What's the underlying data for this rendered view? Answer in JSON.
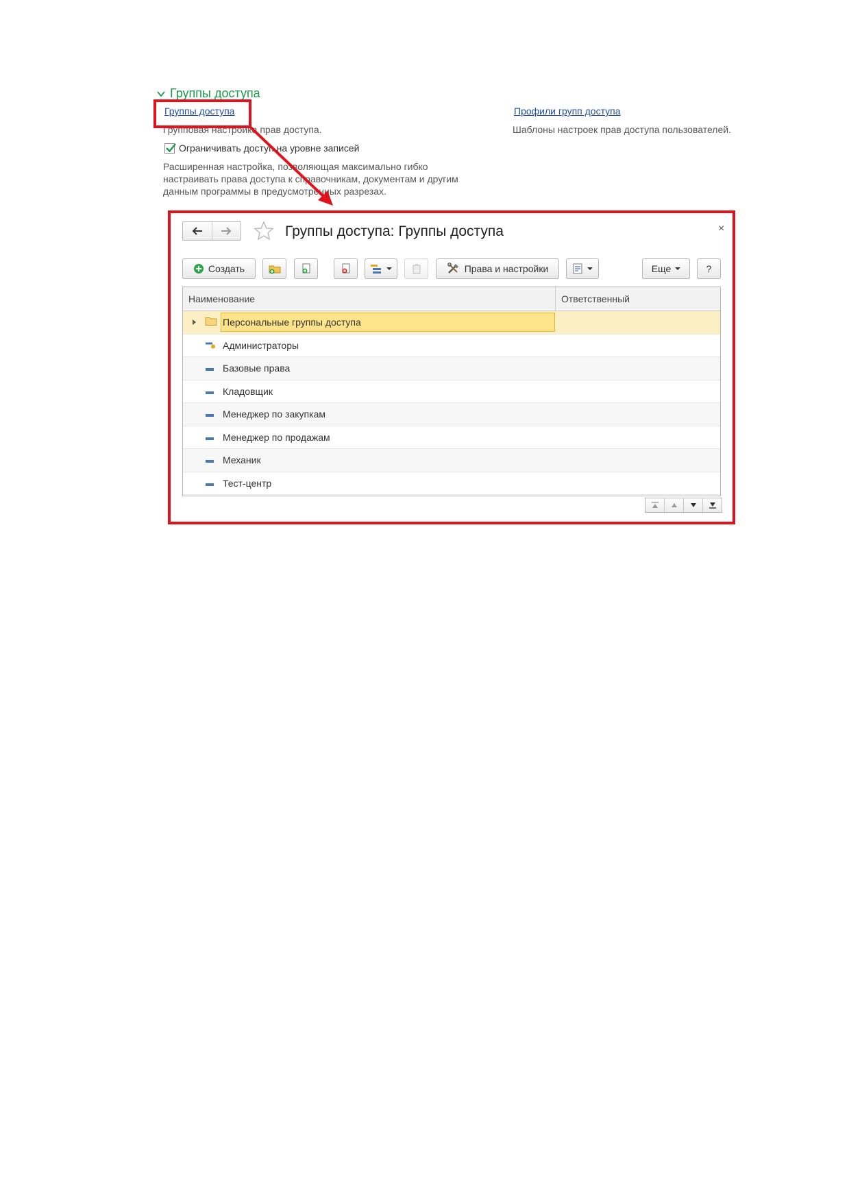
{
  "settings": {
    "section_title": "Группы доступа",
    "link_access_groups": "Группы доступа",
    "desc_access_groups": "Групповая настройка прав доступа.",
    "link_profiles": "Профили групп доступа",
    "desc_profiles": "Шаблоны настроек прав доступа пользователей.",
    "checkbox_label": "Ограничивать доступ на уровне записей",
    "checkbox_checked": true,
    "checkbox_desc_lines": [
      "Расширенная настройка, позволяющая максимально гибко",
      "настраивать права доступа к справочникам, документам и другим",
      "данным программы в предусмотренных разрезах."
    ]
  },
  "window": {
    "title": "Группы доступа: Группы доступа",
    "close_glyph": "×",
    "toolbar": {
      "create_label": "Создать",
      "rights_label": "Права и настройки",
      "more_label": "Еще",
      "help_label": "?"
    },
    "table": {
      "columns": [
        "Наименование",
        "Ответственный"
      ],
      "rows": [
        {
          "name": "Персональные группы доступа",
          "icon": "folder-icon",
          "selected": true
        },
        {
          "name": "Администраторы",
          "icon": "admin-group-icon"
        },
        {
          "name": "Базовые права",
          "icon": "group-item-icon"
        },
        {
          "name": "Кладовщик",
          "icon": "group-item-icon"
        },
        {
          "name": "Менеджер по закупкам",
          "icon": "group-item-icon"
        },
        {
          "name": "Менеджер по продажам",
          "icon": "group-item-icon"
        },
        {
          "name": "Механик",
          "icon": "group-item-icon"
        },
        {
          "name": "Тест-центр",
          "icon": "group-item-icon"
        }
      ]
    }
  },
  "colors": {
    "highlight_red": "#e0121b",
    "section_green": "#1a9a4a",
    "link_blue": "#1f4fa8",
    "selected_row": "#fbefc3"
  }
}
